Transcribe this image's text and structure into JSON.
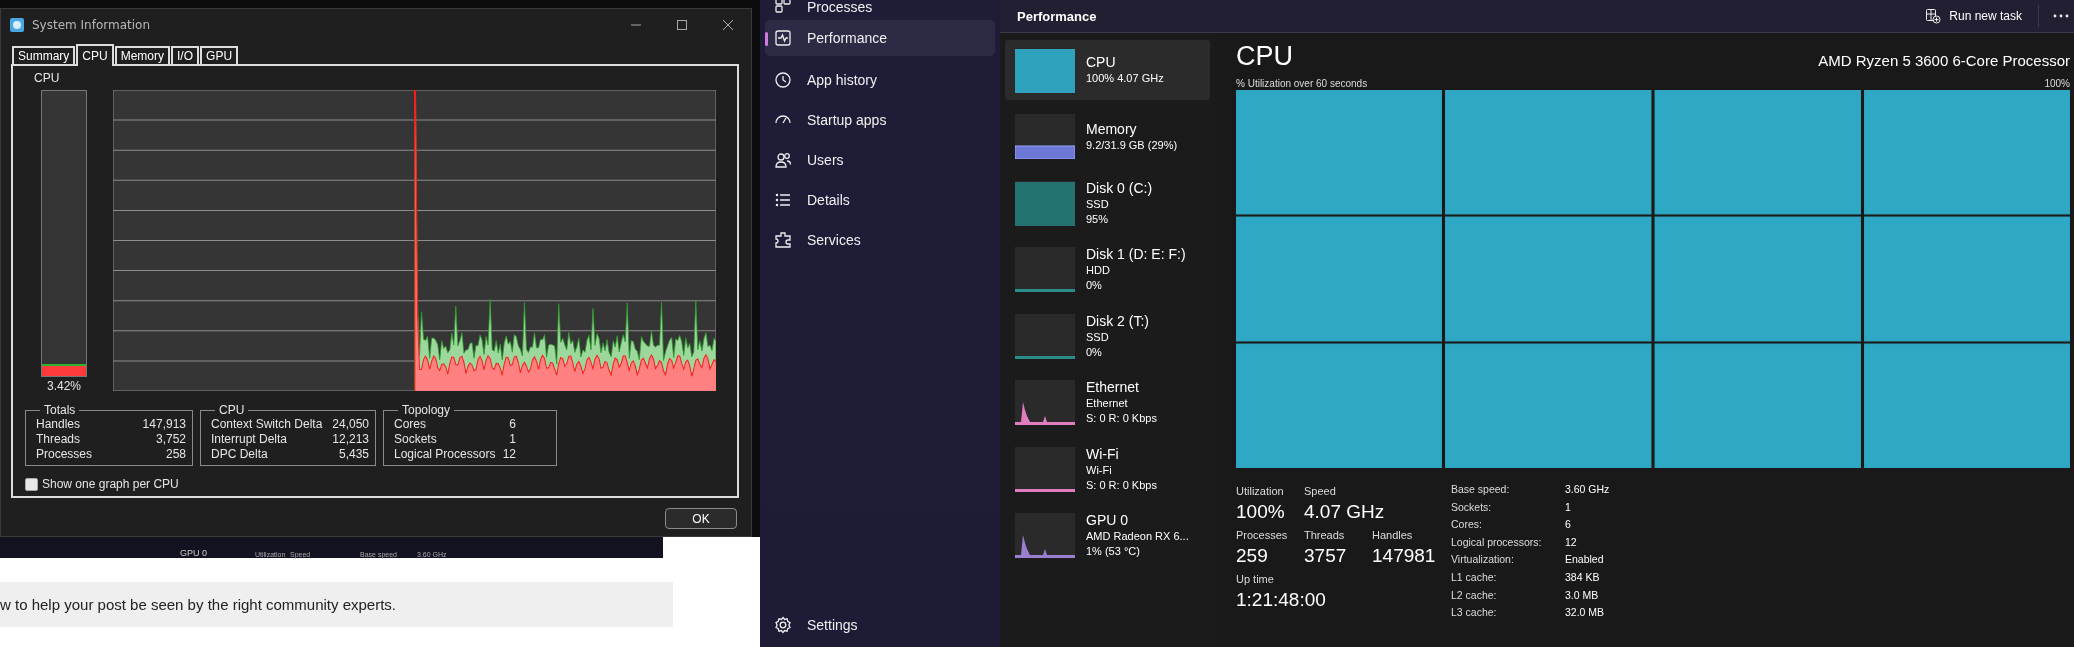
{
  "system_info": {
    "title": "System Information",
    "tabs": [
      {
        "label": "Summary",
        "selected": false
      },
      {
        "label": "CPU",
        "selected": true
      },
      {
        "label": "Memory",
        "selected": false
      },
      {
        "label": "I/O",
        "selected": false
      },
      {
        "label": "GPU",
        "selected": false
      }
    ],
    "cpu_label": "CPU",
    "meter": {
      "level": 0.0342,
      "reading": "3.42%"
    },
    "groups": [
      {
        "title": "Totals",
        "rows": [
          {
            "label": "Handles",
            "value": "147,913"
          },
          {
            "label": "Threads",
            "value": "3,752"
          },
          {
            "label": "Processes",
            "value": "258"
          }
        ]
      },
      {
        "title": "CPU",
        "rows": [
          {
            "label": "Context Switch Delta",
            "value": "24,050"
          },
          {
            "label": "Interrupt Delta",
            "value": "12,213"
          },
          {
            "label": "DPC Delta",
            "value": "5,435"
          }
        ]
      },
      {
        "title": "Topology",
        "rows": [
          {
            "label": "Cores",
            "value": "6"
          },
          {
            "label": "Sockets",
            "value": "1"
          },
          {
            "label": "Logical Processors",
            "value": "12"
          }
        ]
      }
    ],
    "checkbox": {
      "label": "Show one graph per CPU",
      "checked": false
    },
    "ok_button": "OK"
  },
  "background_page": {
    "thumbnail_texts": [
      "GPU 0",
      "Utilization",
      "Speed",
      "Base speed",
      "3.60 GHz"
    ],
    "notice": "w to help your post be seen by the right community experts."
  },
  "task_manager": {
    "nav": [
      {
        "label": "Processes",
        "selected": false
      },
      {
        "label": "Performance",
        "selected": true
      },
      {
        "label": "App history",
        "selected": false
      },
      {
        "label": "Startup apps",
        "selected": false
      },
      {
        "label": "Users",
        "selected": false
      },
      {
        "label": "Details",
        "selected": false
      },
      {
        "label": "Services",
        "selected": false
      }
    ],
    "settings": "Settings",
    "header": {
      "title": "Performance",
      "action": "Run new task"
    },
    "resources": [
      {
        "name": "CPU",
        "lines": [
          "100%  4.07 GHz"
        ],
        "color": "#2fa3bd",
        "kind": "full",
        "selected": true
      },
      {
        "name": "Memory",
        "lines": [
          "9.2/31.9 GB (29%)"
        ],
        "color": "#6d78d6",
        "kind": "band",
        "selected": false
      },
      {
        "name": "Disk 0 (C:)",
        "lines": [
          "SSD",
          "95%"
        ],
        "color": "#237370",
        "kind": "full",
        "selected": false
      },
      {
        "name": "Disk 1 (D: E: F:)",
        "lines": [
          "HDD",
          "0%"
        ],
        "color": "#2a8c86",
        "kind": "flat",
        "selected": false
      },
      {
        "name": "Disk 2 (T:)",
        "lines": [
          "SSD",
          "0%"
        ],
        "color": "#2a8c86",
        "kind": "flat",
        "selected": false
      },
      {
        "name": "Ethernet",
        "lines": [
          "Ethernet",
          "S: 0 R: 0 Kbps"
        ],
        "color": "#e07cc0",
        "kind": "spikes",
        "selected": false
      },
      {
        "name": "Wi-Fi",
        "lines": [
          "Wi-Fi",
          "S: 0 R: 0 Kbps"
        ],
        "color": "#e07cc0",
        "kind": "flat",
        "selected": false
      },
      {
        "name": "GPU 0",
        "lines": [
          "AMD Radeon RX 6...",
          "1%  (53 °C)"
        ],
        "color": "#9a7ed0",
        "kind": "spikes",
        "selected": false
      }
    ],
    "detail": {
      "title": "CPU",
      "processor": "AMD Ryzen 5 3600 6-Core Processor",
      "graph_label": "% Utilization over 60 seconds",
      "graph_max": "100%",
      "stat_rows": [
        [
          {
            "label": "Utilization",
            "value": "100%"
          },
          {
            "label": "Speed",
            "value": "4.07 GHz"
          }
        ],
        [
          {
            "label": "Processes",
            "value": "259"
          },
          {
            "label": "Threads",
            "value": "3757"
          },
          {
            "label": "Handles",
            "value": "147981"
          }
        ],
        [
          {
            "label": "Up time",
            "value": "1:21:48:00"
          }
        ]
      ],
      "specs": [
        {
          "label": "Base speed:",
          "value": "3.60 GHz"
        },
        {
          "label": "Sockets:",
          "value": "1"
        },
        {
          "label": "Cores:",
          "value": "6"
        },
        {
          "label": "Logical processors:",
          "value": "12"
        },
        {
          "label": "Virtualization:",
          "value": "Enabled"
        },
        {
          "label": "L1 cache:",
          "value": "384 KB"
        },
        {
          "label": "L2 cache:",
          "value": "3.0 MB"
        },
        {
          "label": "L3 cache:",
          "value": "32.0 MB"
        }
      ]
    }
  }
}
